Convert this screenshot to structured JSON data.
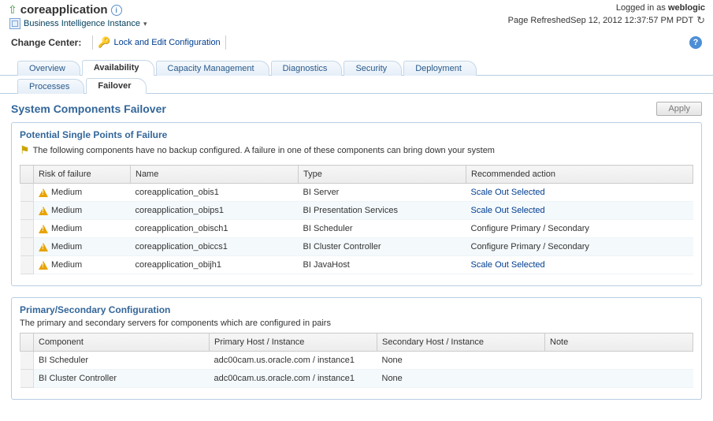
{
  "header": {
    "title": "coreapplication",
    "subtitle": "Business Intelligence Instance",
    "logged_in_prefix": "Logged in as ",
    "logged_in_user": "weblogic",
    "page_refreshed_prefix": "Page Refreshed ",
    "page_refreshed_time": "Sep 12, 2012 12:37:57 PM PDT"
  },
  "change_center": {
    "label": "Change Center:",
    "lock_link": "Lock and Edit Configuration"
  },
  "tabs": {
    "main": [
      "Overview",
      "Availability",
      "Capacity Management",
      "Diagnostics",
      "Security",
      "Deployment"
    ],
    "main_active": 1,
    "sub": [
      "Processes",
      "Failover"
    ],
    "sub_active": 1
  },
  "content": {
    "title": "System Components Failover",
    "apply": "Apply"
  },
  "failure_panel": {
    "title": "Potential Single Points of Failure",
    "desc": "The following components have no backup configured. A failure in one of these components can bring down your system",
    "columns": [
      "Risk of failure",
      "Name",
      "Type",
      "Recommended action"
    ],
    "rows": [
      {
        "risk": "Medium",
        "name": "coreapplication_obis1",
        "type": "BI Server",
        "action": "Scale Out Selected",
        "action_link": true
      },
      {
        "risk": "Medium",
        "name": "coreapplication_obips1",
        "type": "BI Presentation Services",
        "action": "Scale Out Selected",
        "action_link": true
      },
      {
        "risk": "Medium",
        "name": "coreapplication_obisch1",
        "type": "BI Scheduler",
        "action": "Configure Primary / Secondary",
        "action_link": false
      },
      {
        "risk": "Medium",
        "name": "coreapplication_obiccs1",
        "type": "BI Cluster Controller",
        "action": "Configure Primary / Secondary",
        "action_link": false
      },
      {
        "risk": "Medium",
        "name": "coreapplication_obijh1",
        "type": "BI JavaHost",
        "action": "Scale Out Selected",
        "action_link": true
      }
    ]
  },
  "primary_panel": {
    "title": "Primary/Secondary Configuration",
    "desc": "The primary and secondary servers for components which are configured in pairs",
    "columns": [
      "Component",
      "Primary Host / Instance",
      "Secondary Host / Instance",
      "Note"
    ],
    "rows": [
      {
        "component": "BI Scheduler",
        "primary": "adc00cam.us.oracle.com / instance1",
        "secondary": "None",
        "note": ""
      },
      {
        "component": "BI Cluster Controller",
        "primary": "adc00cam.us.oracle.com / instance1",
        "secondary": "None",
        "note": ""
      }
    ]
  }
}
